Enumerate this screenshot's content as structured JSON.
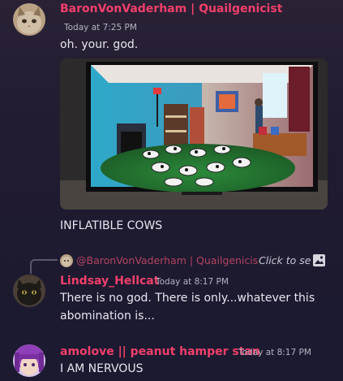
{
  "messages": [
    {
      "author": "BaronVonVaderham | Quailgenicist",
      "timestamp": "Today at 7:25 PM",
      "lines": [
        "oh. your. god."
      ],
      "attachment_caption": "INFLATIBLE COWS"
    },
    {
      "reply": {
        "author": "@BaronVonVaderham | Quailgenicist",
        "action": "Click to se"
      },
      "author": "Lindsay_Hellcat",
      "timestamp": "Today at 8:17 PM",
      "lines": [
        "There is no god. There is only...whatever this",
        "abomination is..."
      ]
    },
    {
      "author": "amolove || peanut hamper stan",
      "timestamp": "Today at 8:17 PM",
      "lines": [
        "I AM NERVOUS"
      ]
    }
  ],
  "colors": {
    "author_name": "#f23f6a",
    "reply_author": "#b3445e",
    "timestamp": "#b5b3c0",
    "text": "#e8e6ee"
  },
  "icons": {
    "reply_image": "image-icon"
  }
}
